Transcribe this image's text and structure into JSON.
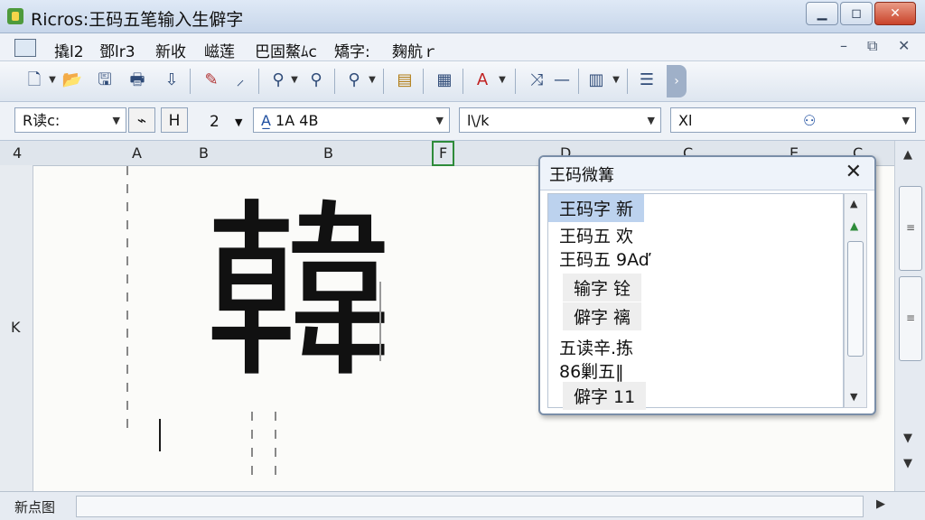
{
  "window": {
    "title": "Ricros:王码五笔输入生僻字",
    "controls": {
      "minimize": "▁",
      "maximize": "◻",
      "close": "✕"
    }
  },
  "menubar": {
    "items": [
      "撬l2",
      "鄧lr3",
      "新收",
      "嵫莲",
      "巴固鰲ﾑc",
      "矯字:",
      "麹航ｒ"
    ],
    "mdi": {
      "minimize": "–",
      "restore": "⧉",
      "close": "✕"
    }
  },
  "toolbar": {
    "icons": [
      "new-doc-icon",
      "open-icon",
      "save-icon",
      "print-icon",
      "down-arrow-icon",
      "pencil-icon",
      "brush-icon",
      "zoom-icon",
      "magnify-icon",
      "search-icon",
      "columns-icon",
      "table-icon",
      "font-color-icon",
      "replace-icon",
      "paragraph-icon",
      "list-icon"
    ]
  },
  "formatbar": {
    "style_combo": "R读c:",
    "size_value": "2",
    "font_sample": "1A 4B",
    "font_combo": "l\\/k",
    "x_combo": "Xl"
  },
  "sheet": {
    "columns": [
      "4",
      "A",
      "B",
      "B",
      "F",
      "D",
      "C",
      "E",
      "C"
    ],
    "selected_column": "F",
    "row_labels": [
      "K"
    ],
    "big_character": "韓"
  },
  "ime": {
    "title": "王码微篝",
    "close": "✕",
    "candidates": [
      {
        "text": "王码字 新",
        "style": "sel"
      },
      {
        "text": "王码五 欢",
        "style": ""
      },
      {
        "text": "王码五 9Aď",
        "style": ""
      },
      {
        "text": "输字 铨",
        "style": "box"
      },
      {
        "text": "僻字 褵",
        "style": "box"
      },
      {
        "text": "五读辛.拣",
        "style": ""
      },
      {
        "text": "86剿五‖",
        "style": ""
      },
      {
        "text": "僻字 11",
        "style": "box"
      }
    ]
  },
  "statusbar": {
    "text": "新点图"
  },
  "colors": {
    "accent": "#2e8b3a",
    "selection": "#bcd2ee",
    "close": "#c9432a"
  }
}
